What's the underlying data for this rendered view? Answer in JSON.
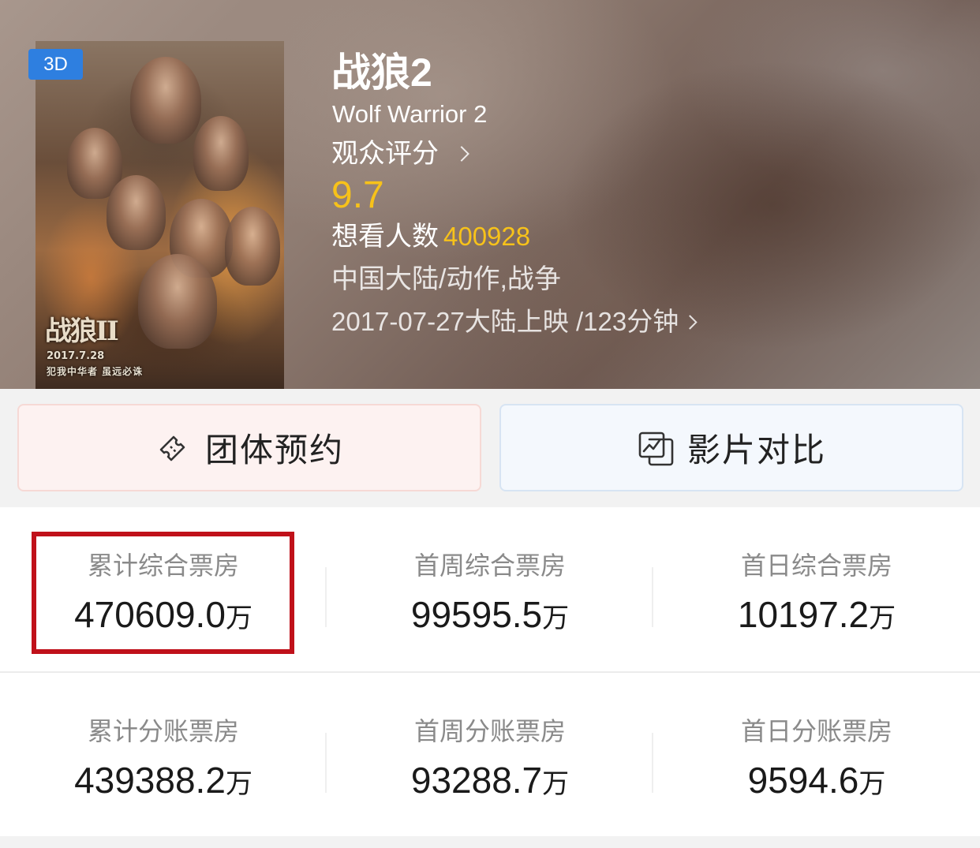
{
  "header": {
    "badge": "3D",
    "poster": {
      "title_art": "战狼II",
      "date_art": "2017.7.28",
      "tagline_art": "犯我中华者 虽远必诛"
    },
    "title": "战狼2",
    "title_en": "Wolf Warrior 2",
    "rating_label": "观众评分",
    "score": "9.7",
    "wish_label": "想看人数",
    "wish_count": "400928",
    "genre": "中国大陆/动作,战争",
    "release": "2017-07-27大陆上映 /123分钟"
  },
  "actions": {
    "group_booking": "团体预约",
    "compare": "影片对比"
  },
  "stats": {
    "unit": "万",
    "row1": [
      {
        "label": "累计综合票房",
        "value": "470609.0"
      },
      {
        "label": "首周综合票房",
        "value": "99595.5"
      },
      {
        "label": "首日综合票房",
        "value": "10197.2"
      }
    ],
    "row2": [
      {
        "label": "累计分账票房",
        "value": "439388.2"
      },
      {
        "label": "首周分账票房",
        "value": "93288.7"
      },
      {
        "label": "首日分账票房",
        "value": "9594.6"
      }
    ]
  },
  "colors": {
    "accent_yellow": "#f7c21a",
    "badge_blue": "#2e7fe0",
    "highlight_red": "#c0111a"
  }
}
